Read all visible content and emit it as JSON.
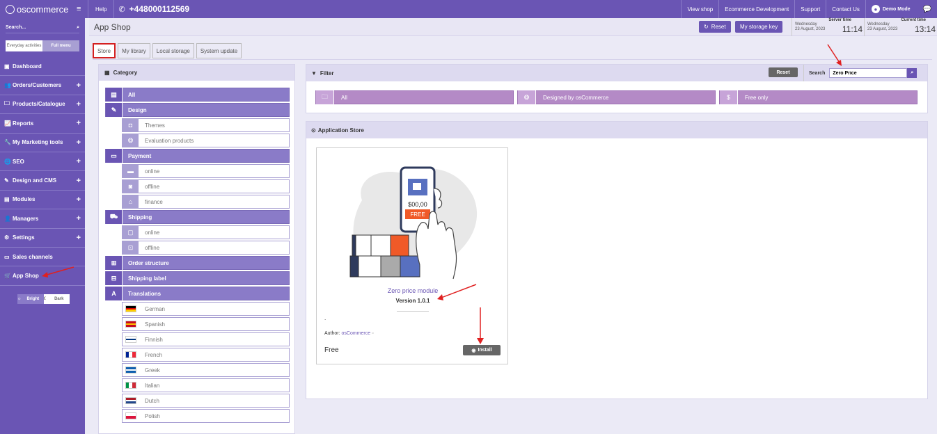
{
  "topbar": {
    "brand": "oscommerce",
    "help": "Help",
    "phone": "+448000112569",
    "links": [
      "View shop",
      "Ecommerce Development",
      "Support",
      "Contact Us"
    ],
    "user": "Demo Mode"
  },
  "sidebar": {
    "search_placeholder": "Search...",
    "toggle_a": "Everyday activities",
    "toggle_b": "Full menu",
    "items": [
      {
        "label": "Dashboard",
        "icon": "dashboard-icon",
        "plus": ""
      },
      {
        "label": "Orders/Customers",
        "icon": "users-icon",
        "plus": "+"
      },
      {
        "label": "Products/Catalogue",
        "icon": "folder-icon",
        "plus": "+"
      },
      {
        "label": "Reports",
        "icon": "chart-icon",
        "plus": "+"
      },
      {
        "label": "My Marketing tools",
        "icon": "wrench-icon",
        "plus": "+"
      },
      {
        "label": "SEO",
        "icon": "globe-icon",
        "plus": "+"
      },
      {
        "label": "Design and CMS",
        "icon": "brush-icon",
        "plus": "+"
      },
      {
        "label": "Modules",
        "icon": "modules-icon",
        "plus": "+"
      },
      {
        "label": "Managers",
        "icon": "manager-icon",
        "plus": "+"
      },
      {
        "label": "Settings",
        "icon": "gear-icon",
        "plus": "+"
      },
      {
        "label": "Sales channels",
        "icon": "monitor-icon",
        "plus": ""
      },
      {
        "label": "App Shop",
        "icon": "cart-icon",
        "plus": ""
      }
    ],
    "mode_bright": "Bright",
    "mode_dark": "Dark"
  },
  "header": {
    "title": "App Shop",
    "reset": "Reset",
    "storage_key": "My storage key",
    "server_label": "Server time",
    "server_day": "Wednesday",
    "server_date": "23 August, 2023",
    "server_time": "11:14",
    "current_label": "Current time",
    "current_day": "Wednesday",
    "current_date": "23 August, 2023",
    "current_time": "13:14"
  },
  "tabs": [
    "Store",
    "My library",
    "Local storage",
    "System update"
  ],
  "category": {
    "title": "Category",
    "rows": [
      {
        "type": "main",
        "label": "All",
        "icon": "all-icon"
      },
      {
        "type": "main",
        "label": "Design",
        "icon": "design-icon"
      },
      {
        "type": "sub",
        "label": "Themes",
        "icon": "themes-icon"
      },
      {
        "type": "sub",
        "label": "Evaluation products",
        "icon": "evaluation-icon"
      },
      {
        "type": "main",
        "label": "Payment",
        "icon": "wallet-icon"
      },
      {
        "type": "sub",
        "label": "online",
        "icon": "card-icon"
      },
      {
        "type": "sub",
        "label": "offline",
        "icon": "cash-icon"
      },
      {
        "type": "sub",
        "label": "finance",
        "icon": "bank-icon"
      },
      {
        "type": "main",
        "label": "Shipping",
        "icon": "truck-icon"
      },
      {
        "type": "sub",
        "label": "online",
        "icon": "box-icon"
      },
      {
        "type": "sub",
        "label": "offline",
        "icon": "trolley-icon"
      },
      {
        "type": "main",
        "label": "Order structure",
        "icon": "order-icon"
      },
      {
        "type": "main",
        "label": "Shipping label",
        "icon": "label-icon"
      },
      {
        "type": "main",
        "label": "Translations",
        "icon": "translate-icon"
      },
      {
        "type": "lang",
        "label": "German",
        "flag": [
          "#000000",
          "#dd0000",
          "#ffce00"
        ]
      },
      {
        "type": "lang",
        "label": "Spanish",
        "flag": [
          "#c60b1e",
          "#ffc400",
          "#c60b1e"
        ]
      },
      {
        "type": "lang",
        "label": "Finnish",
        "flag": [
          "#ffffff",
          "#003580",
          "#ffffff"
        ]
      },
      {
        "type": "lang",
        "label": "French",
        "flag": [
          "#002395",
          "#ffffff",
          "#ed2939"
        ],
        "vertical": true
      },
      {
        "type": "lang",
        "label": "Greek",
        "flag": [
          "#0d5eaf",
          "#ffffff",
          "#0d5eaf"
        ]
      },
      {
        "type": "lang",
        "label": "Italian",
        "flag": [
          "#009246",
          "#ffffff",
          "#ce2b37"
        ],
        "vertical": true
      },
      {
        "type": "lang",
        "label": "Dutch",
        "flag": [
          "#ae1c28",
          "#ffffff",
          "#21468b"
        ]
      },
      {
        "type": "lang",
        "label": "Polish",
        "flag": [
          "#ffffff",
          "#dc143c"
        ]
      }
    ]
  },
  "filter": {
    "title": "Filter",
    "reset": "Reset",
    "search_label": "Search",
    "search_value": "Zero Price",
    "buttons": [
      {
        "label": "All",
        "icon": "folder-icon"
      },
      {
        "label": "Designed by osCommerce",
        "icon": "network-icon"
      },
      {
        "label": "Free only",
        "icon": "dollar-icon"
      }
    ]
  },
  "store": {
    "title": "Application Store",
    "app": {
      "price_tag": "$00,00",
      "free_tag": "FREE",
      "name": "Zero price module",
      "version": "Version 1.0.1",
      "dot": ".",
      "author_label": "Author:",
      "author_link": "osCommerce",
      "price": "Free",
      "install": "Install"
    }
  },
  "colors": {
    "brand": "#6a55b4",
    "brand_light": "#8a7bc8",
    "filter_button": "#b48ac6",
    "annotation_red": "#e02020"
  }
}
